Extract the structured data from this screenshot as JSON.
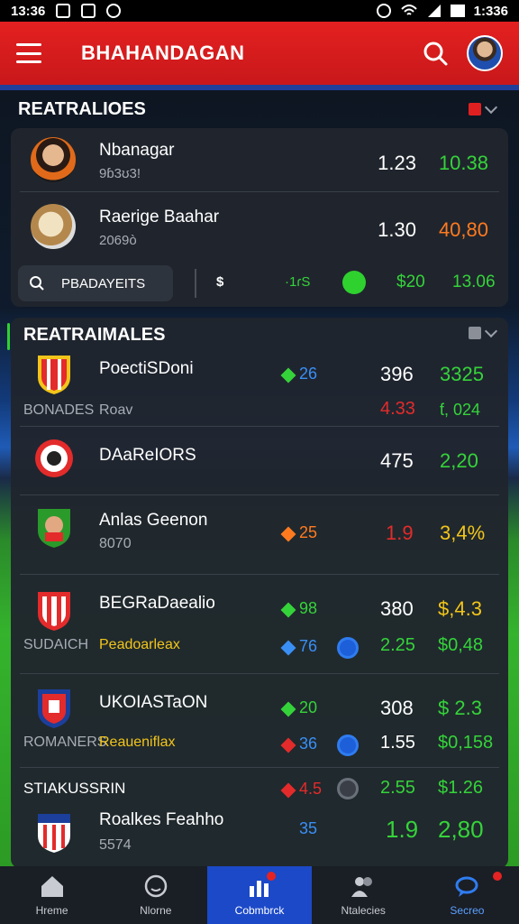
{
  "status_bar": {
    "time_left": "13:36",
    "time_right": "1:336"
  },
  "app_bar": {
    "title": "BHAHANDAGAN"
  },
  "section1": {
    "title": "REATRALIOES",
    "rows": [
      {
        "name": "Nbanagar",
        "sub": "9ɓ3ʊ3!",
        "val1": "1.23",
        "val2": "10.38",
        "val2_color": "#35d33a"
      },
      {
        "name": "Raerige Baahar",
        "sub": "2069ò",
        "val1": "1.30",
        "val2": "40,80",
        "val2_color": "#ff7a1f"
      }
    ],
    "bottom": {
      "predict_label": "PBADAYEITS",
      "dollar": "$",
      "g1": "·1ɾS",
      "g2": "$20",
      "g3": "13.06"
    }
  },
  "section2": {
    "title": "REATRAIMALES",
    "matches": [
      {
        "team": "PoectiSDoni",
        "sub_left": "BONADES",
        "sub_right": "Roav",
        "odd": "26",
        "val1": "396",
        "val2": "3325",
        "val3": "4.33",
        "val4": "ƭ, 024"
      },
      {
        "team": "DAaReIORS",
        "val1": "475",
        "val2": "2,20"
      },
      {
        "team": "Anlas Geenon",
        "sub": "8070",
        "odd": "25",
        "val1": "1.9",
        "val2": "3,4%"
      },
      {
        "team": "BEGRaDaealio",
        "sub_left": "SUDAICH",
        "sub_right": "Peadoarleax",
        "odd1": "98",
        "odd2": "76",
        "val1": "380",
        "val2": "$,4.3",
        "val3": "2.25",
        "val4": "$0,48"
      },
      {
        "team": "UKOIASTaON",
        "sub_left": "ROMANERS",
        "sub_right": "Reaueniflax",
        "odd1": "20",
        "odd2": "36",
        "val1": "308",
        "val2": "$ 2.3",
        "val3": "1.55",
        "val4": "$0,158"
      },
      {
        "header": "STIAKUSSRIN",
        "team": "Roalkes Feahho",
        "sub": "5574",
        "odd1": "4.5",
        "odd2": "35",
        "val0": "2.55",
        "val0b": "$1.26",
        "val1": "1.9",
        "val2": "2,80"
      }
    ]
  },
  "bottom_nav": {
    "items": [
      {
        "label": "Hreme",
        "icon": "home-icon"
      },
      {
        "label": "Nlorne",
        "icon": "face-icon"
      },
      {
        "label": "Cobmbrck",
        "icon": "chart-icon"
      },
      {
        "label": "Ntalecies",
        "icon": "people-icon"
      },
      {
        "label": "Secreo",
        "icon": "chat-icon"
      }
    ]
  },
  "colors": {
    "brand_red": "#e42020",
    "nav_active": "#1b49c8",
    "positive_green": "#35d33a",
    "negative_red": "#e32b2b",
    "warning_orange": "#ff7a1f",
    "highlight_yellow": "#f2c51a",
    "info_blue": "#3a8ff5"
  }
}
